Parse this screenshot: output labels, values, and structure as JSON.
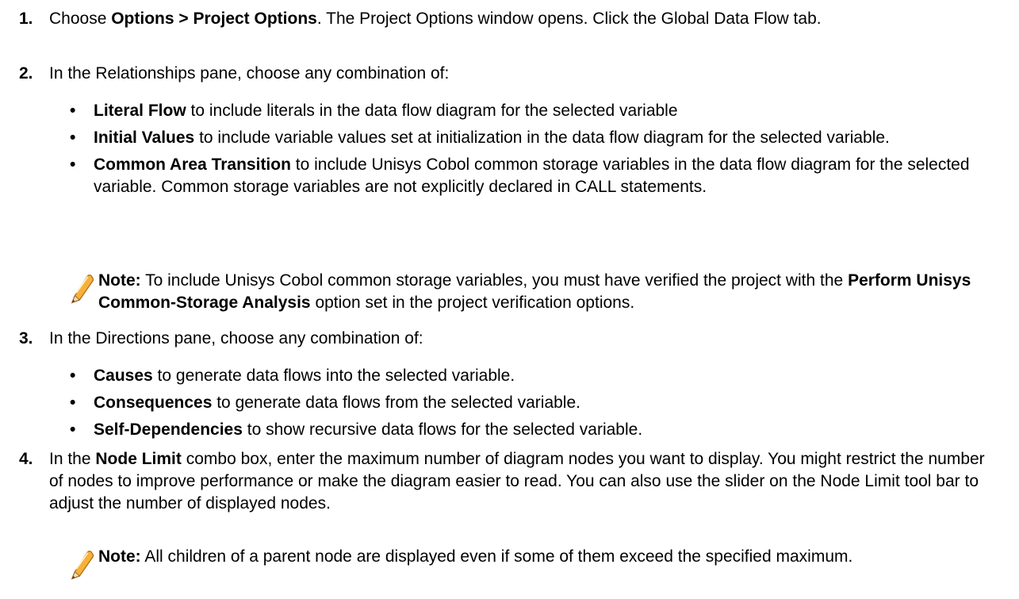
{
  "steps": [
    {
      "number": "1.",
      "pre": "Choose ",
      "bold": "Options > Project Options",
      "post": ". The Project Options window opens. Click the Global Data Flow tab."
    },
    {
      "number": "2.",
      "text": "In the Relationships pane, choose any combination of:",
      "bullets": [
        {
          "bold": "Literal Flow",
          "text": " to include literals in the data flow diagram for the selected variable"
        },
        {
          "bold": "Initial Values",
          "text": " to include variable values set at initialization in the data flow diagram for the selected variable."
        },
        {
          "bold": "Common Area Transition",
          "text": " to include Unisys Cobol common storage variables in the data flow diagram for the selected variable. Common storage variables are not explicitly declared in CALL statements."
        }
      ],
      "note": {
        "label": "Note:",
        "pre": " To include Unisys Cobol common storage variables, you must have verified the project with the ",
        "bold": "Perform Unisys Common-Storage Analysis",
        "post": " option set in the project verification options.",
        "icon": "pencil-icon"
      }
    },
    {
      "number": "3.",
      "text": "In the Directions pane, choose any combination of:",
      "bullets": [
        {
          "bold": "Causes",
          "text": " to generate data flows into the selected variable."
        },
        {
          "bold": "Consequences",
          "text": " to generate data flows from the selected variable."
        },
        {
          "bold": "Self-Dependencies",
          "text": " to show recursive data flows for the selected variable."
        }
      ]
    },
    {
      "number": "4.",
      "pre": "In the ",
      "bold": "Node Limit",
      "post": " combo box, enter the maximum number of diagram nodes you want to display. You might restrict the number of nodes to improve performance or make the diagram easier to read. You can also use the slider on the Node Limit tool bar to adjust the number of displayed nodes.",
      "note": {
        "label": "Note:",
        "text": " All children of a parent node are displayed even if some of them exceed the specified maximum.",
        "icon": "pencil-icon"
      }
    }
  ],
  "colors": {
    "text": "#000000",
    "pencil_body": "#f5a623",
    "pencil_tip": "#6b3a1a"
  }
}
